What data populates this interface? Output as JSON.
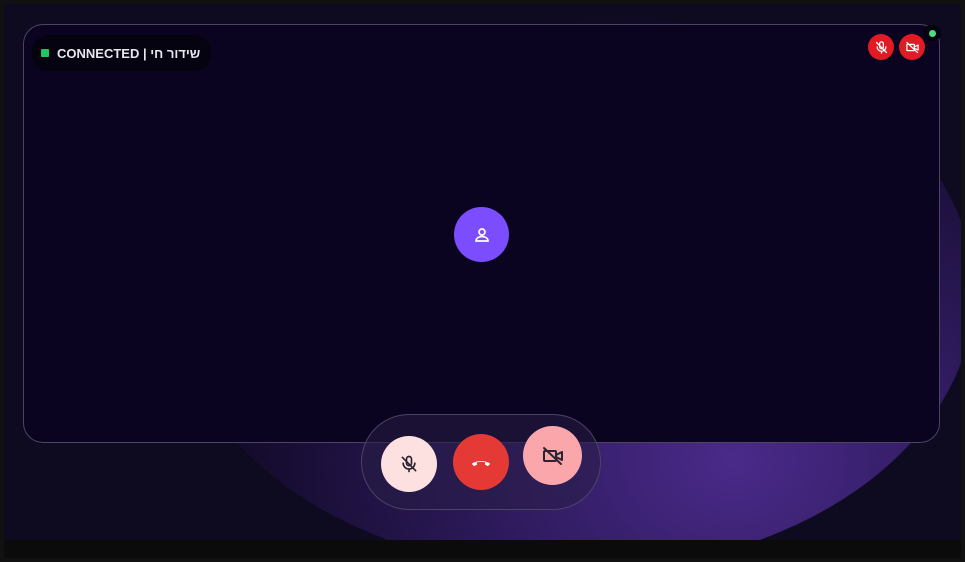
{
  "status": {
    "label": "שידור חי | CONNECTED",
    "indicator_color": "#22c55e"
  },
  "remote_indicators": {
    "mic_icon": "mic-off-icon",
    "camera_icon": "camera-off-icon",
    "color": "#e01b24"
  },
  "online_indicator": {
    "color": "#4ade80"
  },
  "participant": {
    "avatar_icon": "person-icon",
    "avatar_color": "#7c4dff"
  },
  "controls": {
    "mic": {
      "icon": "mic-off-icon",
      "color": "#fde1e1"
    },
    "hangup": {
      "icon": "phone-hangup-icon",
      "color": "#e53935"
    },
    "camera": {
      "icon": "camera-off-icon",
      "color": "#fba6ab"
    }
  }
}
